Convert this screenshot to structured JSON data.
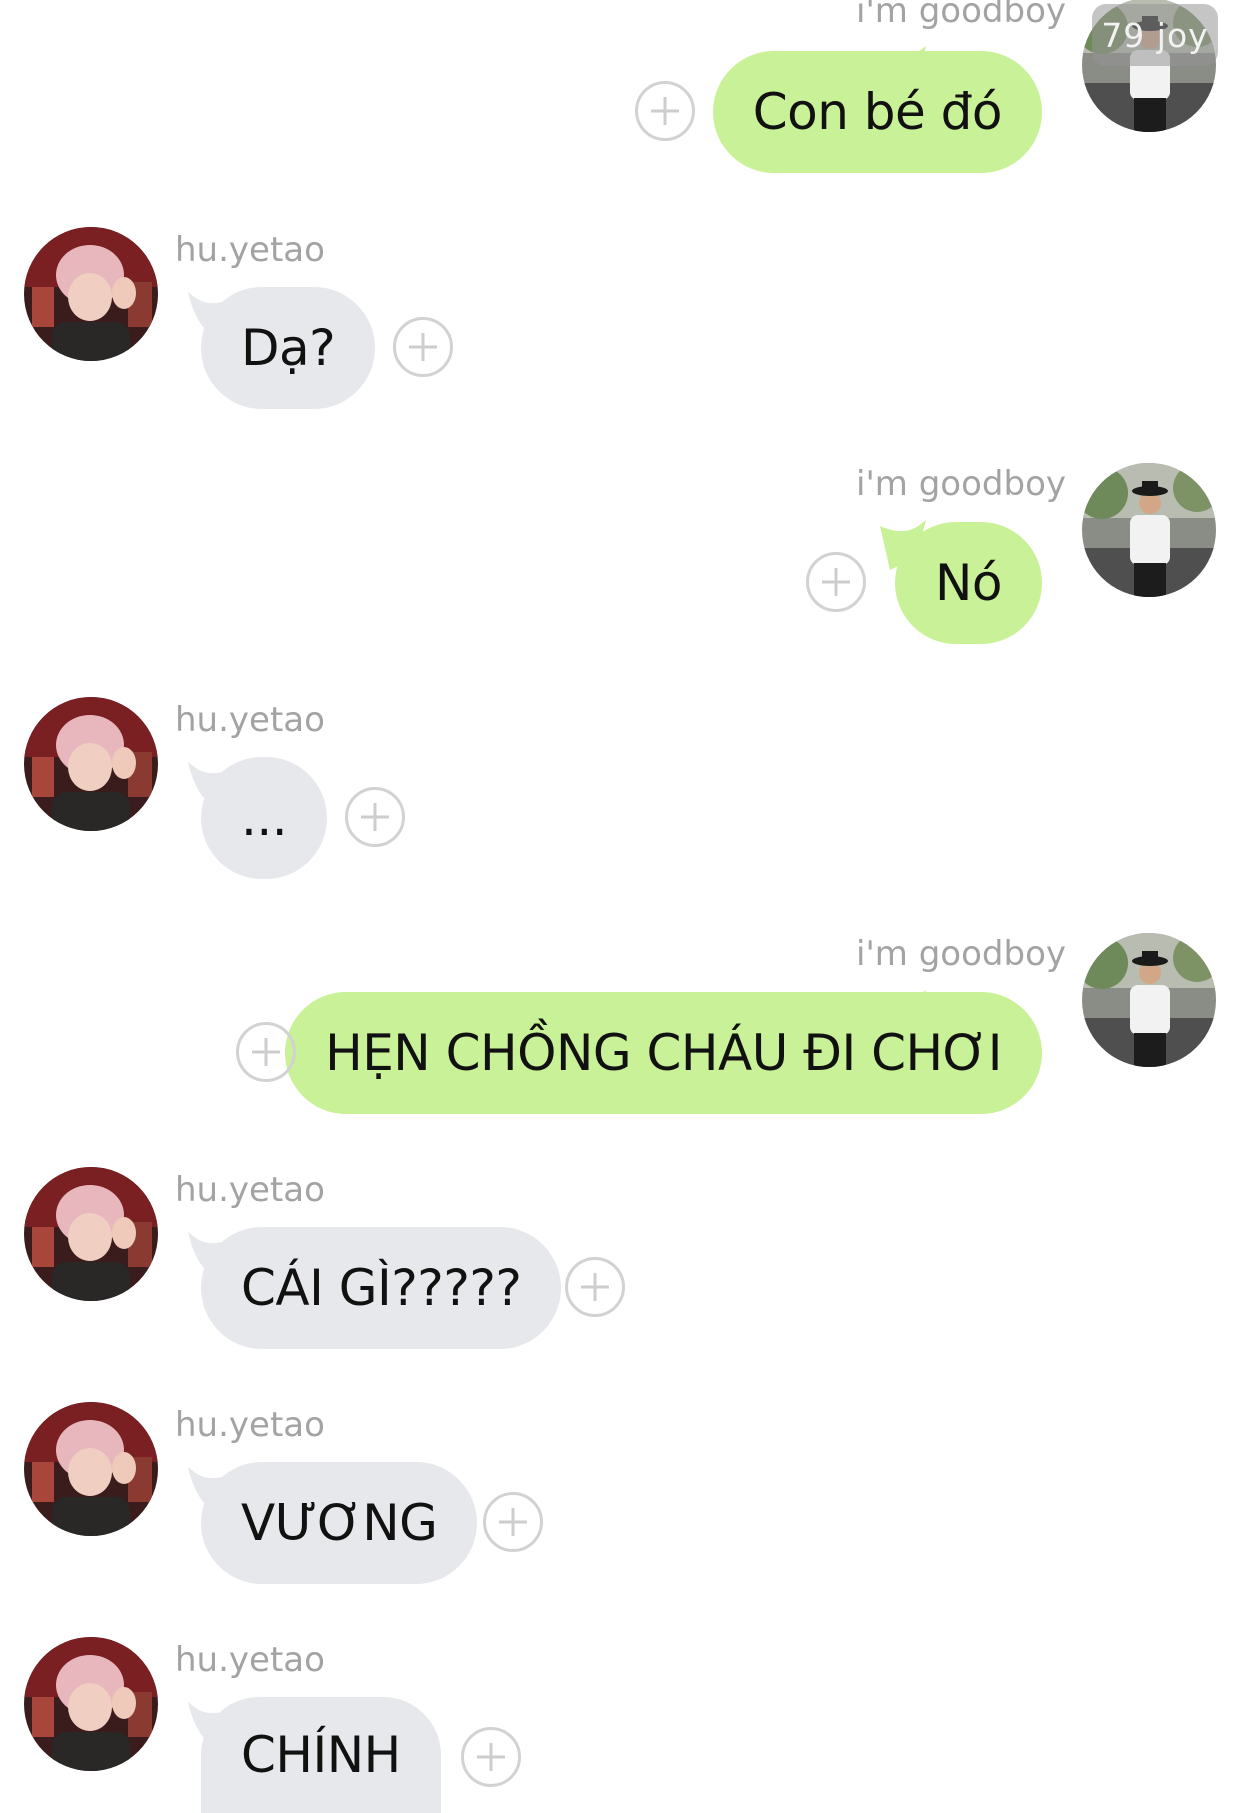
{
  "conversation": {
    "messages": [
      {
        "direction": "out",
        "sender": "i'm goodboy",
        "text": "Con bé đó"
      },
      {
        "direction": "in",
        "sender": "hu.yetao",
        "text": "Dạ?"
      },
      {
        "direction": "out",
        "sender": "i'm goodboy",
        "text": "Nó"
      },
      {
        "direction": "in",
        "sender": "hu.yetao",
        "text": "..."
      },
      {
        "direction": "out",
        "sender": "i'm goodboy",
        "text": "HẸN CHỒNG CHÁU ĐI CHƠI"
      },
      {
        "direction": "in",
        "sender": "hu.yetao",
        "text": "CÁI GÌ?????"
      },
      {
        "direction": "in",
        "sender": "hu.yetao",
        "text": "VƯƠNG"
      },
      {
        "direction": "in",
        "sender": "hu.yetao",
        "text": "CHÍNH"
      }
    ]
  },
  "watermark": {
    "text": "79 joy"
  },
  "colors": {
    "outgoing_bubble": "#c9f197",
    "incoming_bubble": "#e7e8eb",
    "sender_name": "#a3a3a3",
    "reaction_button": "#d2d2d2"
  },
  "icons": {
    "reaction_button": "plus-circle-icon"
  }
}
